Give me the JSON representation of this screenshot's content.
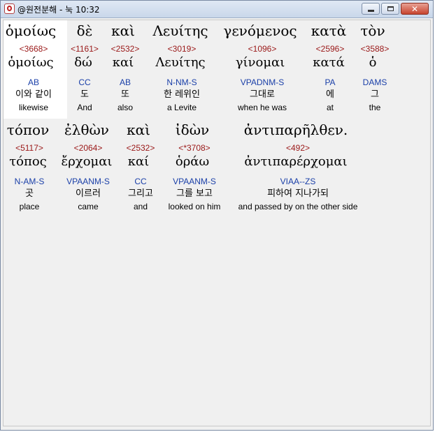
{
  "window": {
    "title": "@원전분해 - 눅 10:32",
    "min_glyph": "",
    "max_glyph": "",
    "close_glyph": "✕"
  },
  "rows": [
    {
      "words": [
        {
          "greek": "ὁμοίως",
          "strong": "<3668>",
          "lemma": "ὁμοίως",
          "parse": "AB",
          "korean": "이와 같이",
          "english": "likewise"
        },
        {
          "greek": "δὲ",
          "strong": "<1161>",
          "lemma": "δώ",
          "parse": "CC",
          "korean": "도",
          "english": "And"
        },
        {
          "greek": "καὶ",
          "strong": "<2532>",
          "lemma": "καί",
          "parse": "AB",
          "korean": "또",
          "english": "also"
        },
        {
          "greek": "Λευίτης",
          "strong": "<3019>",
          "lemma": "Λευίτης",
          "parse": "N-NM-S",
          "korean": "한 레위인",
          "english": "a Levite"
        },
        {
          "greek": "γενόμενος",
          "strong": "<1096>",
          "lemma": "γίνομαι",
          "parse": "VPADNM-S",
          "korean": "그대로",
          "english": "when he was"
        },
        {
          "greek": "κατὰ",
          "strong": "<2596>",
          "lemma": "κατά",
          "parse": "PA",
          "korean": "에",
          "english": "at"
        },
        {
          "greek": "τὸν",
          "strong": "<3588>",
          "lemma": "ὁ",
          "parse": "DAMS",
          "korean": "그",
          "english": "the"
        }
      ]
    },
    {
      "words": [
        {
          "greek": "τόπον",
          "strong": "<5117>",
          "lemma": "τόπος",
          "parse": "N-AM-S",
          "korean": "곳",
          "english": "place"
        },
        {
          "greek": "ἐλθὼν",
          "strong": "<2064>",
          "lemma": "ἔρχομαι",
          "parse": "VPAANM-S",
          "korean": "이르러",
          "english": "came"
        },
        {
          "greek": "καὶ",
          "strong": "<2532>",
          "lemma": "καί",
          "parse": "CC",
          "korean": "그리고",
          "english": "and"
        },
        {
          "greek": "ἰδὼν",
          "strong": "<*3708>",
          "lemma": "ὁράω",
          "parse": "VPAANM-S",
          "korean": "그를 보고",
          "english": "looked on him"
        },
        {
          "greek": "ἀντιπαρῆλθεν.",
          "strong": "<492>",
          "lemma": "ἀντιπαρέρχομαι",
          "parse": "VIAA--ZS",
          "korean": "피하여 지나가되",
          "english": "and passed by on the other side"
        }
      ]
    }
  ]
}
